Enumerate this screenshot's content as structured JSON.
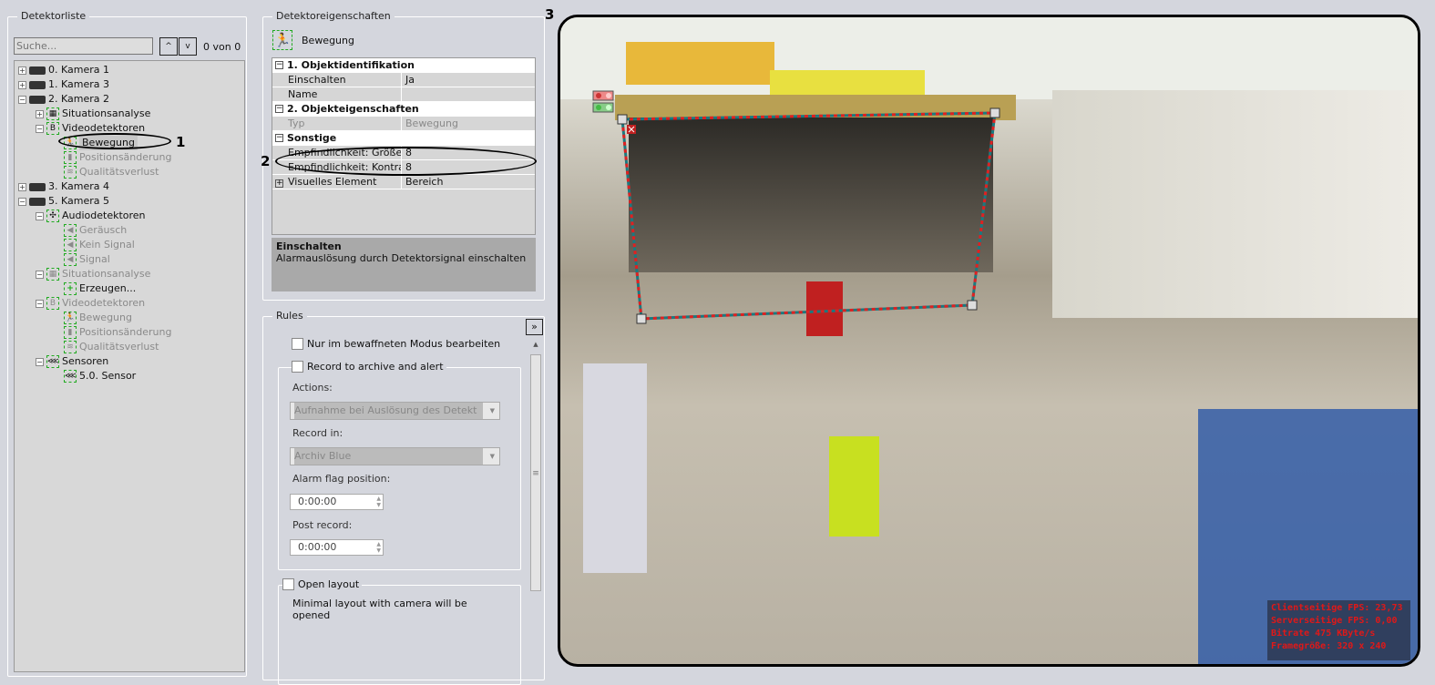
{
  "detector_list": {
    "title": "Detektorliste",
    "search_placeholder": "Suche...",
    "counter": "0 von 0",
    "tree": [
      {
        "label": "0. Kamera 1",
        "level": 0,
        "icon": "camera-icon",
        "expander": "+",
        "disabled": false
      },
      {
        "label": "1. Kamera 3",
        "level": 0,
        "icon": "camera-icon",
        "expander": "+",
        "disabled": false
      },
      {
        "label": "2. Kamera 2",
        "level": 0,
        "icon": "camera-icon",
        "expander": "-",
        "disabled": false
      },
      {
        "label": "Situationsanalyse",
        "level": 1,
        "icon": "situation-analysis-icon",
        "expander": "+",
        "disabled": false
      },
      {
        "label": "Videodetektoren",
        "level": 1,
        "icon": "video-detector-icon",
        "expander": "-",
        "disabled": false
      },
      {
        "label": "Bewegung",
        "level": 2,
        "icon": "motion-icon",
        "expander": "",
        "disabled": false,
        "selected": true
      },
      {
        "label": "Positionsänderung",
        "level": 2,
        "icon": "position-change-icon",
        "expander": "",
        "disabled": true
      },
      {
        "label": "Qualitätsverlust",
        "level": 2,
        "icon": "quality-loss-icon",
        "expander": "",
        "disabled": true
      },
      {
        "label": "3. Kamera 4",
        "level": 0,
        "icon": "camera-icon",
        "expander": "+",
        "disabled": false
      },
      {
        "label": "5. Kamera 5",
        "level": 0,
        "icon": "camera-icon",
        "expander": "-",
        "disabled": false
      },
      {
        "label": "Audiodetektoren",
        "level": 1,
        "icon": "audio-detector-icon",
        "expander": "-",
        "disabled": false
      },
      {
        "label": "Geräusch",
        "level": 2,
        "icon": "speaker-icon",
        "expander": "",
        "disabled": true
      },
      {
        "label": "Kein Signal",
        "level": 2,
        "icon": "speaker-icon",
        "expander": "",
        "disabled": true
      },
      {
        "label": "Signal",
        "level": 2,
        "icon": "speaker-icon",
        "expander": "",
        "disabled": true
      },
      {
        "label": "Situationsanalyse",
        "level": 1,
        "icon": "situation-analysis-icon",
        "expander": "-",
        "disabled": true
      },
      {
        "label": "Erzeugen...",
        "level": 2,
        "icon": "add-icon",
        "expander": "",
        "disabled": false
      },
      {
        "label": "Videodetektoren",
        "level": 1,
        "icon": "video-detector-icon",
        "expander": "-",
        "disabled": true
      },
      {
        "label": "Bewegung",
        "level": 2,
        "icon": "motion-icon",
        "expander": "",
        "disabled": true
      },
      {
        "label": "Positionsänderung",
        "level": 2,
        "icon": "position-change-icon",
        "expander": "",
        "disabled": true
      },
      {
        "label": "Qualitätsverlust",
        "level": 2,
        "icon": "quality-loss-icon",
        "expander": "",
        "disabled": true
      },
      {
        "label": "Sensoren",
        "level": 1,
        "icon": "sensor-icon",
        "expander": "-",
        "disabled": false
      },
      {
        "label": "5.0. Sensor",
        "level": 2,
        "icon": "sensor-icon",
        "expander": "",
        "disabled": false
      }
    ]
  },
  "properties": {
    "title": "Detektoreigenschaften",
    "object_name": "Bewegung",
    "rows": [
      {
        "type": "cat",
        "key": "1. Objektidentifikation",
        "expander": "-"
      },
      {
        "type": "prop",
        "key": "Einschalten",
        "value": "Ja"
      },
      {
        "type": "prop",
        "key": "Name",
        "value": ""
      },
      {
        "type": "cat",
        "key": "2. Objekteigenschaften",
        "expander": "-"
      },
      {
        "type": "prop",
        "key": "Typ",
        "value": "Bewegung",
        "disabled": true
      },
      {
        "type": "cat",
        "key": "Sonstige",
        "expander": "-"
      },
      {
        "type": "prop",
        "key": "Empfindlichkeit: Größe",
        "value": "8"
      },
      {
        "type": "prop",
        "key": "Empfindlichkeit: Kontrast",
        "value": "8"
      },
      {
        "type": "prop",
        "key": "Visuelles Element",
        "value": "Bereich",
        "expander": "+"
      }
    ],
    "description_title": "Einschalten",
    "description_text": "Alarmauslösung durch Detektorsignal einschalten"
  },
  "rules": {
    "title": "Rules",
    "expand_button": "»",
    "armed_only": "Nur im bewaffneten Modus bearbeiten",
    "record_alert": "Record to archive and alert",
    "actions_label": "Actions:",
    "actions_value": "Aufnahme bei Auslösung des Detekt",
    "record_in_label": "Record in:",
    "record_in_value": "Archiv Blue",
    "alarm_flag_label": "Alarm flag position:",
    "alarm_flag_value": "0:00:00",
    "post_record_label": "Post record:",
    "post_record_value": "0:00:00",
    "open_layout": "Open layout",
    "open_layout_desc": "Minimal layout with camera will be opened"
  },
  "video": {
    "stats": [
      "Clientseitige FPS: 23,73",
      "Serverseitige FPS: 0,00",
      "Bitrate 475 KByte/s",
      "Framegröße: 320 x 240"
    ],
    "zone_color": "#e02020",
    "stats_color": "#e01818"
  },
  "annotations": [
    "1",
    "2",
    "3"
  ]
}
